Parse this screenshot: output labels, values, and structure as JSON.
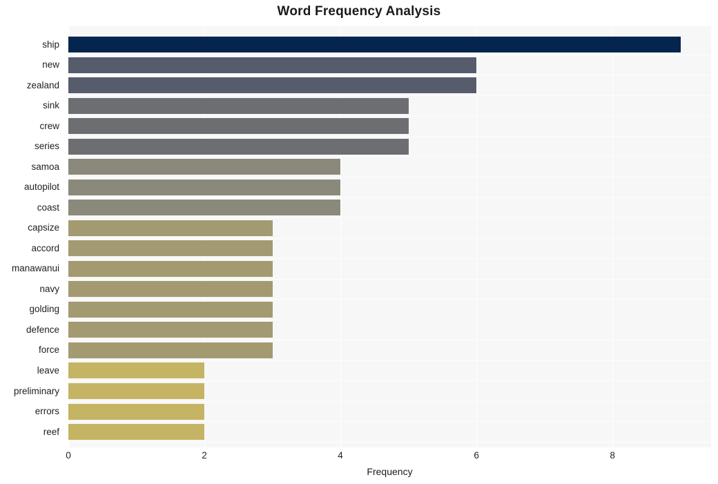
{
  "chart_data": {
    "type": "bar",
    "orientation": "horizontal",
    "title": "Word Frequency Analysis",
    "xlabel": "Frequency",
    "ylabel": "",
    "categories": [
      "ship",
      "new",
      "zealand",
      "sink",
      "crew",
      "series",
      "samoa",
      "autopilot",
      "coast",
      "capsize",
      "accord",
      "manawanui",
      "navy",
      "golding",
      "defence",
      "force",
      "leave",
      "preliminary",
      "errors",
      "reef"
    ],
    "values": [
      9,
      6,
      6,
      5,
      5,
      5,
      4,
      4,
      4,
      3,
      3,
      3,
      3,
      3,
      3,
      3,
      2,
      2,
      2,
      2
    ],
    "bar_colors": [
      "#04254e",
      "#565c6c",
      "#565c6c",
      "#6d6e71",
      "#6d6e71",
      "#6d6e71",
      "#8a897b",
      "#8a897b",
      "#8a897b",
      "#a39a71",
      "#a39a71",
      "#a39a71",
      "#a39a71",
      "#a39a71",
      "#a39a71",
      "#a39a71",
      "#c4b464",
      "#c4b464",
      "#c4b464",
      "#c4b464"
    ],
    "xlim": [
      0,
      9.45
    ],
    "xticks": [
      0,
      2,
      4,
      6,
      8
    ],
    "xticklabels": [
      "0",
      "2",
      "4",
      "6",
      "8"
    ],
    "grid": true,
    "grid_axis": "x",
    "legend": null,
    "plot_background": "#f7f7f7",
    "figure_background": "#ffffff",
    "gridline_color": "#ffffff"
  }
}
